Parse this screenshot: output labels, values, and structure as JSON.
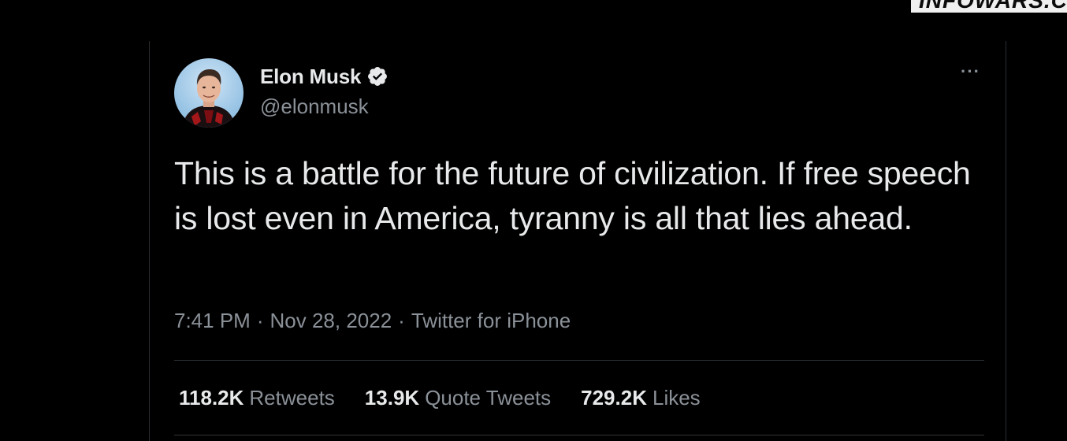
{
  "watermark": {
    "text": "INFOWARS.C"
  },
  "tweet": {
    "author": {
      "name": "Elon Musk",
      "handle": "@elonmusk",
      "verified": true
    },
    "more_label": "···",
    "text": "This is a battle for the future of civilization. If free speech is lost even in America, tyranny is all that lies ahead.",
    "time": "7:41 PM",
    "date": "Nov 28, 2022",
    "source": "Twitter for iPhone",
    "separator": "·",
    "stats": [
      {
        "count": "118.2K",
        "label": "Retweets"
      },
      {
        "count": "13.9K",
        "label": "Quote Tweets"
      },
      {
        "count": "729.2K",
        "label": "Likes"
      }
    ]
  },
  "colors": {
    "background": "#000000",
    "text_primary": "#e7e9ea",
    "text_secondary": "#8b9198",
    "divider": "#2f3336"
  }
}
